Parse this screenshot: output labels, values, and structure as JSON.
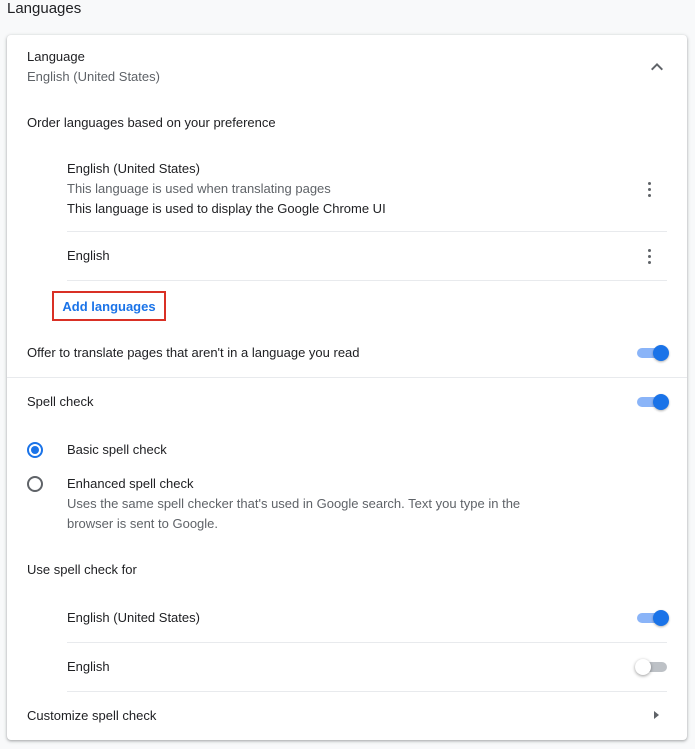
{
  "page": {
    "title": "Languages"
  },
  "language": {
    "label": "Language",
    "current": "English (United States)",
    "expanded": true
  },
  "order": {
    "heading": "Order languages based on your preference",
    "items": [
      {
        "name": "English (United States)",
        "notes": [
          "This language is used when translating pages",
          "This language is used to display the Google Chrome UI"
        ]
      },
      {
        "name": "English",
        "notes": []
      }
    ],
    "add_label": "Add languages"
  },
  "translate": {
    "label": "Offer to translate pages that aren't in a language you read",
    "enabled": true
  },
  "spellcheck": {
    "label": "Spell check",
    "enabled": true,
    "options": [
      {
        "label": "Basic spell check",
        "selected": true,
        "description": ""
      },
      {
        "label": "Enhanced spell check",
        "selected": false,
        "description_line1": "Uses the same spell checker that's used in Google search. Text you type in the",
        "description_line2": "browser is sent to Google."
      }
    ],
    "use_for_heading": "Use spell check for",
    "languages": [
      {
        "name": "English (United States)",
        "enabled": true
      },
      {
        "name": "English",
        "enabled": false
      }
    ],
    "customize_label": "Customize spell check"
  },
  "colors": {
    "accent": "#1a73e8",
    "highlight_border": "#d93025"
  }
}
